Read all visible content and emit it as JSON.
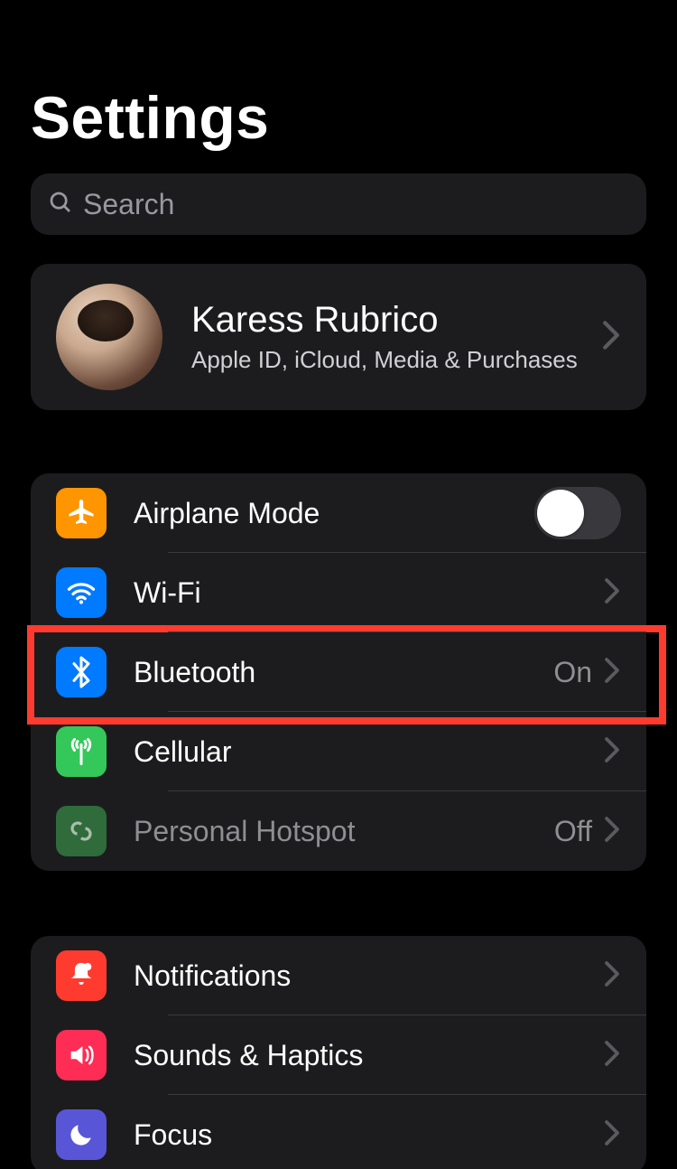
{
  "header": {
    "title": "Settings"
  },
  "search": {
    "placeholder": "Search"
  },
  "profile": {
    "name": "Karess Rubrico",
    "subtitle": "Apple ID, iCloud, Media & Purchases"
  },
  "groups": [
    {
      "items": [
        {
          "key": "airplane",
          "label": "Airplane Mode",
          "icon": "airplane-icon",
          "color": "orange",
          "control": "toggle",
          "toggle_on": false
        },
        {
          "key": "wifi",
          "label": "Wi-Fi",
          "icon": "wifi-icon",
          "color": "blue",
          "control": "disclosure",
          "value": ""
        },
        {
          "key": "bluetooth",
          "label": "Bluetooth",
          "icon": "bluetooth-icon",
          "color": "blue",
          "control": "disclosure",
          "value": "On",
          "highlighted": true
        },
        {
          "key": "cellular",
          "label": "Cellular",
          "icon": "cellular-icon",
          "color": "green",
          "control": "disclosure",
          "value": ""
        },
        {
          "key": "hotspot",
          "label": "Personal Hotspot",
          "icon": "hotspot-icon",
          "color": "greenD",
          "control": "disclosure",
          "value": "Off",
          "dim": true
        }
      ]
    },
    {
      "items": [
        {
          "key": "notifications",
          "label": "Notifications",
          "icon": "bell-icon",
          "color": "red",
          "control": "disclosure"
        },
        {
          "key": "sounds",
          "label": "Sounds & Haptics",
          "icon": "speaker-icon",
          "color": "pink",
          "control": "disclosure"
        },
        {
          "key": "focus",
          "label": "Focus",
          "icon": "moon-icon",
          "color": "indigo",
          "control": "disclosure"
        }
      ]
    }
  ]
}
